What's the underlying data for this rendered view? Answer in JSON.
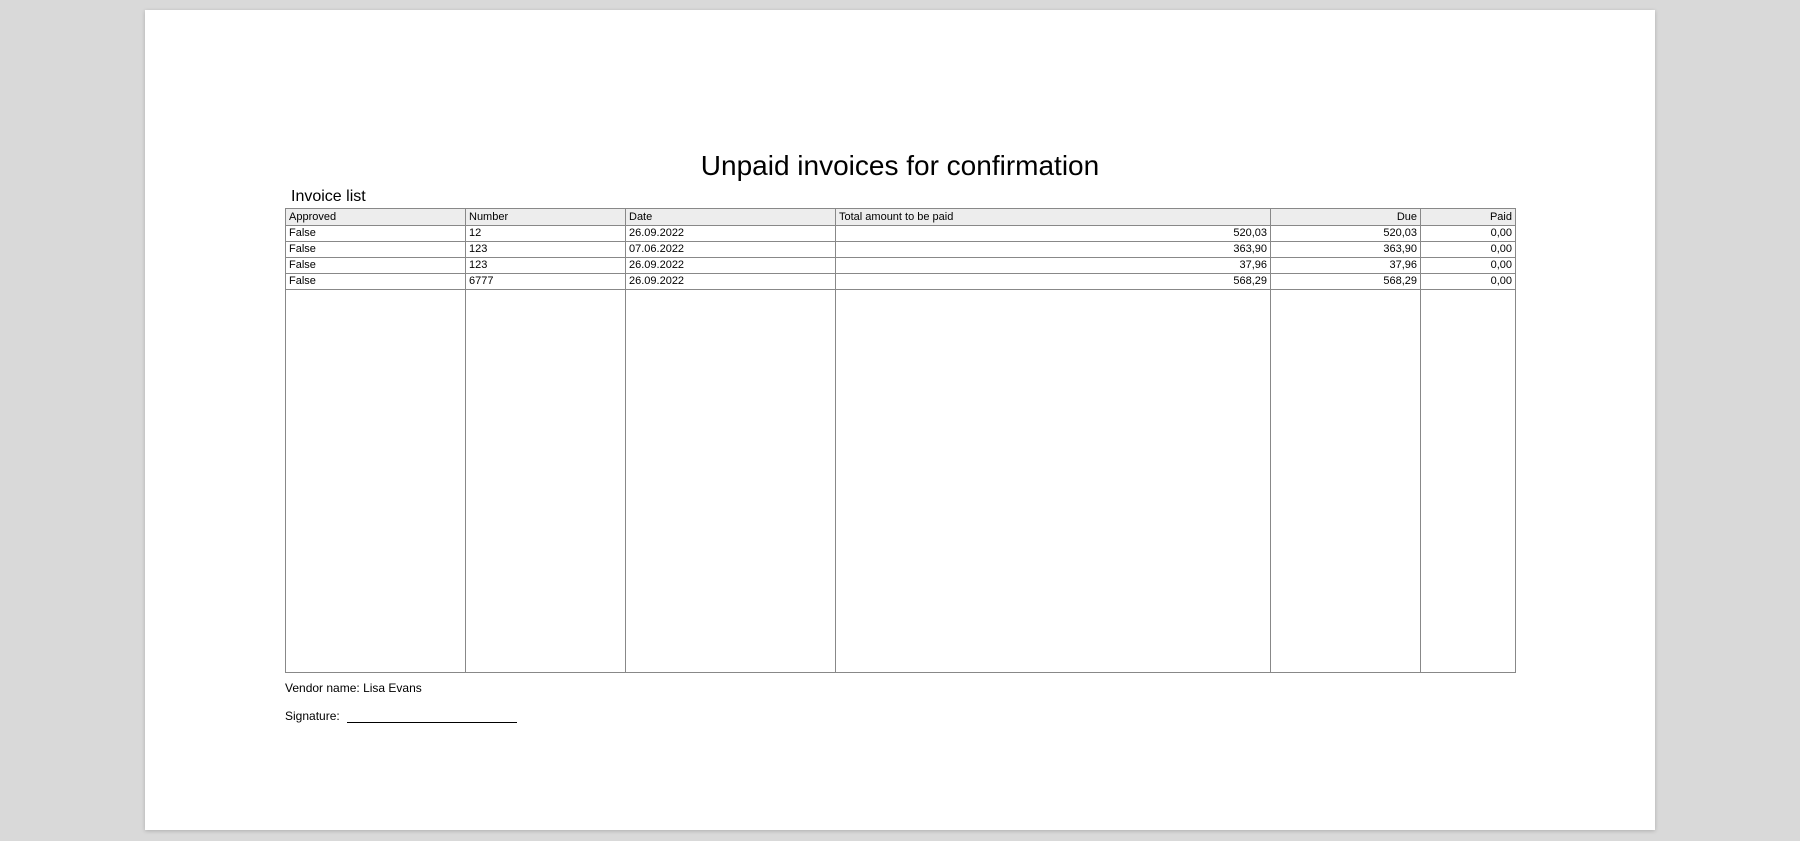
{
  "document": {
    "title": "Unpaid invoices for confirmation",
    "section_label": "Invoice list"
  },
  "table": {
    "headers": {
      "approved": "Approved",
      "number": "Number",
      "date": "Date",
      "total": "Total amount to be paid",
      "due": "Due",
      "paid": "Paid"
    },
    "rows": [
      {
        "approved": "False",
        "number": "12",
        "date": "26.09.2022",
        "total": "520,03",
        "due": "520,03",
        "paid": "0,00"
      },
      {
        "approved": "False",
        "number": "123",
        "date": "07.06.2022",
        "total": "363,90",
        "due": "363,90",
        "paid": "0,00"
      },
      {
        "approved": "False",
        "number": "123",
        "date": "26.09.2022",
        "total": "37,96",
        "due": "37,96",
        "paid": "0,00"
      },
      {
        "approved": "False",
        "number": "6777",
        "date": "26.09.2022",
        "total": "568,29",
        "due": "568,29",
        "paid": "0,00"
      }
    ]
  },
  "footer": {
    "vendor_label": "Vendor name:",
    "vendor_value": "Lisa Evans",
    "signature_label": "Signature:"
  }
}
